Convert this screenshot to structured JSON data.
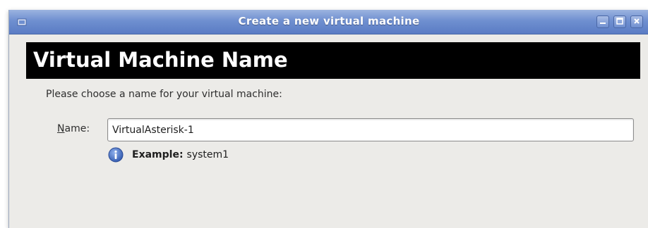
{
  "window": {
    "title": "Create a new virtual machine"
  },
  "page": {
    "heading": "Virtual Machine Name",
    "instruction": "Please choose a name for your virtual machine:"
  },
  "form": {
    "name_label_mnemonic": "N",
    "name_label_rest": "ame:",
    "name_value": "VirtualAsterisk-1"
  },
  "hint": {
    "label": "Example:",
    "value": "system1"
  },
  "icons": {
    "window_icon": "app-icon",
    "info_icon": "info-icon",
    "minimize": "minimize-icon",
    "maximize": "maximize-icon",
    "close": "close-icon"
  },
  "colors": {
    "titlebar": "#6f8fd0",
    "header_bg": "#000000",
    "window_bg": "#ecebe8",
    "info_blue": "#3d63b8"
  }
}
